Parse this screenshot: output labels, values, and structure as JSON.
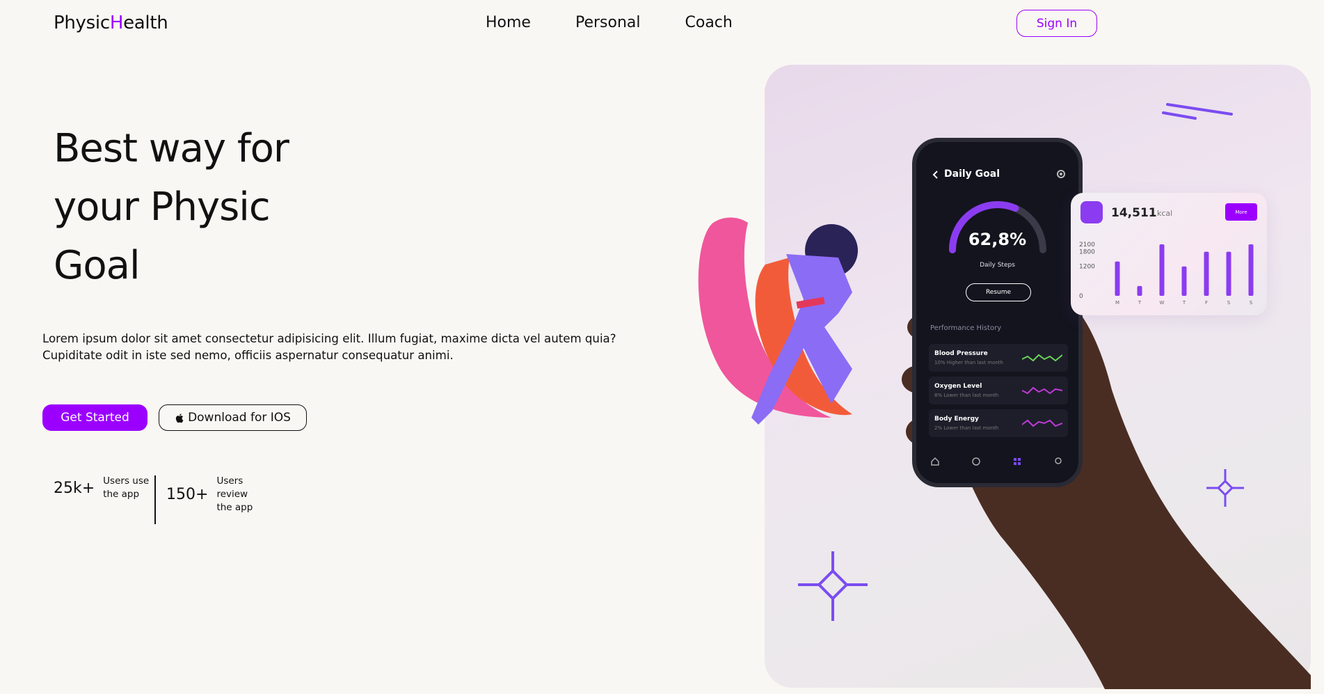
{
  "brand": {
    "logo_start": "Physic",
    "logo_accent": "H",
    "logo_end": "ealth"
  },
  "nav": {
    "items": [
      {
        "label": "Home"
      },
      {
        "label": "Personal"
      },
      {
        "label": "Coach"
      }
    ],
    "signin_label": "Sign In"
  },
  "hero": {
    "title_line1": "Best way for",
    "title_line2": "your Physic",
    "title_line3": "Goal",
    "description": "Lorem ipsum dolor sit amet consectetur adipisicing elit. Illum fugiat, maxime dicta vel autem quia? Cupiditate odit in iste sed nemo, officiis aspernatur consequatur animi.",
    "primary_cta": "Get Started",
    "secondary_cta": "Download for IOS"
  },
  "stats": [
    {
      "value": "25k+",
      "label_line1": "Users use",
      "label_line2": "the app"
    },
    {
      "value": "150+",
      "label_line1": "Users review",
      "label_line2": "the app"
    }
  ],
  "phone": {
    "title": "Daily Goal",
    "gauge_value": "62,8%",
    "gauge_progress": 0.628,
    "gauge_label": "Daily Steps",
    "resume_label": "Resume",
    "performance_title": "Performance History",
    "rows": [
      {
        "name": "Blood Pressure",
        "sub": "10% Higher than last month"
      },
      {
        "name": "Oxygen Level",
        "sub": "8% Lower than last month"
      },
      {
        "name": "Body Energy",
        "sub": "2% Lower than last month"
      }
    ]
  },
  "kcal_card": {
    "value": "14,511",
    "unit": "kcal",
    "more_label": "More",
    "chart_data": {
      "type": "bar",
      "categories": [
        "M",
        "T",
        "W",
        "T",
        "F",
        "S",
        "S"
      ],
      "values": [
        1400,
        400,
        2100,
        1200,
        1800,
        1800,
        2100
      ],
      "ylim": [
        0,
        2100
      ],
      "yticks": [
        "2100",
        "1800",
        "1200",
        "0"
      ]
    }
  },
  "colors": {
    "accent": "#9b00ff",
    "chart_bar": "#8b3cf0",
    "background": "#f9f7f3"
  }
}
